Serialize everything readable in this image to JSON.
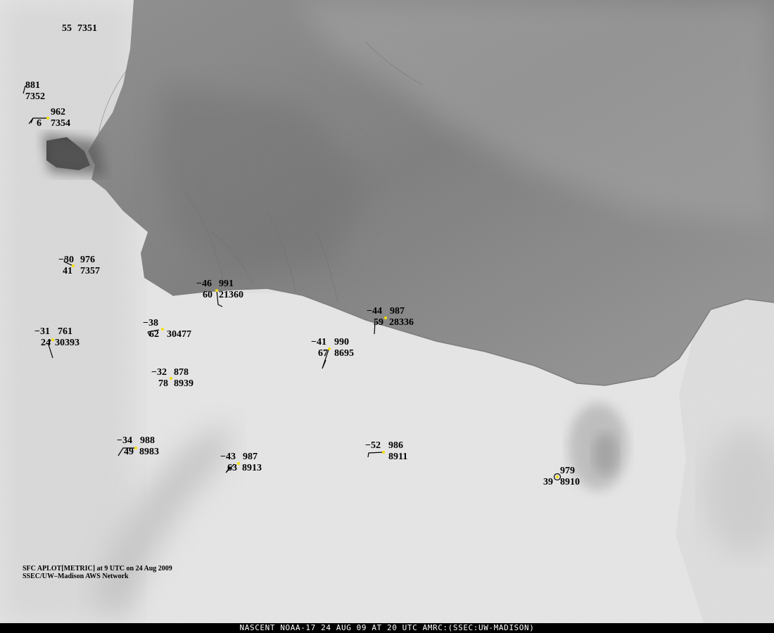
{
  "caption": {
    "line1": "SFC APLOT[METRIC] at 9 UTC on 24 Aug 2009",
    "line2": "SSEC/UW–Madison AWS Network"
  },
  "footer": "NASCENT NOAA-17 24 AUG 09 AT 20 UTC AMRC:(SSEC:UW-MADISON)",
  "colors": {
    "station_dot": "#f5e000",
    "plot_text": "#000000",
    "footer_bg": "#000000",
    "footer_text": "#ffffff"
  },
  "stations": [
    {
      "id": "s7351",
      "temp": "",
      "pressure": "55",
      "dewpoint": "",
      "code": "7351"
    },
    {
      "id": "s7352",
      "temp": "",
      "pressure": "881",
      "dewpoint": "",
      "code": "7352"
    },
    {
      "id": "s7354",
      "temp": "",
      "pressure": "962",
      "dewpoint": "6",
      "code": "7354"
    },
    {
      "id": "s7357",
      "temp": "−30",
      "pressure": "976",
      "dewpoint": "41",
      "code": "7357"
    },
    {
      "id": "s21360",
      "temp": "−46",
      "pressure": "991",
      "dewpoint": "60",
      "code": "21360"
    },
    {
      "id": "s30393",
      "temp": "−31",
      "pressure": "761",
      "dewpoint": "24",
      "code": "30393"
    },
    {
      "id": "s30477",
      "temp": "−38",
      "pressure": "",
      "dewpoint": "62",
      "code": "30477"
    },
    {
      "id": "s28336",
      "temp": "−44",
      "pressure": "987",
      "dewpoint": "59",
      "code": "28336"
    },
    {
      "id": "s8695",
      "temp": "−41",
      "pressure": "990",
      "dewpoint": "67",
      "code": "8695"
    },
    {
      "id": "s8939",
      "temp": "−32",
      "pressure": "878",
      "dewpoint": "78",
      "code": "8939"
    },
    {
      "id": "s8983",
      "temp": "−34",
      "pressure": "988",
      "dewpoint": "49",
      "code": "8983"
    },
    {
      "id": "s8913",
      "temp": "−43",
      "pressure": "987",
      "dewpoint": "63",
      "code": "8913"
    },
    {
      "id": "s8911",
      "temp": "−52",
      "pressure": "986",
      "dewpoint": "",
      "code": "8911"
    },
    {
      "id": "s8910",
      "temp": "",
      "pressure": "979",
      "dewpoint": "39",
      "code": "8910"
    }
  ]
}
